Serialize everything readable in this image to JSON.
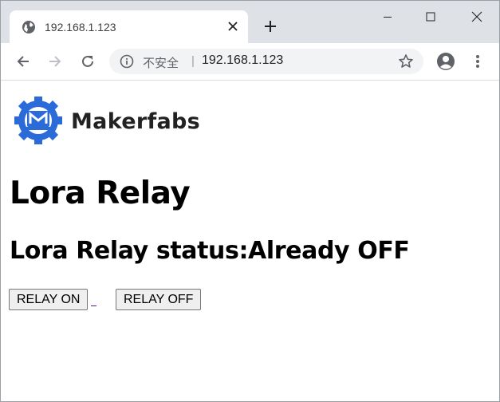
{
  "browser": {
    "tab": {
      "title": "192.168.1.123",
      "favicon": "globe-icon"
    },
    "omnibox": {
      "security_label": "不安全",
      "separator": "|",
      "url": "192.168.1.123"
    }
  },
  "page": {
    "logo": {
      "text": "Makerfabs",
      "icon": "makerfabs-gear-logo"
    },
    "title": "Lora Relay",
    "status": "Lora Relay status:Already OFF",
    "buttons": {
      "on_label": "RELAY ON",
      "off_label": "RELAY OFF"
    }
  },
  "colors": {
    "tabstrip": "#dee1e6",
    "omnibox": "#f1f3f4",
    "logo_blue": "#2a6ad9",
    "button_bg": "#efefef"
  }
}
